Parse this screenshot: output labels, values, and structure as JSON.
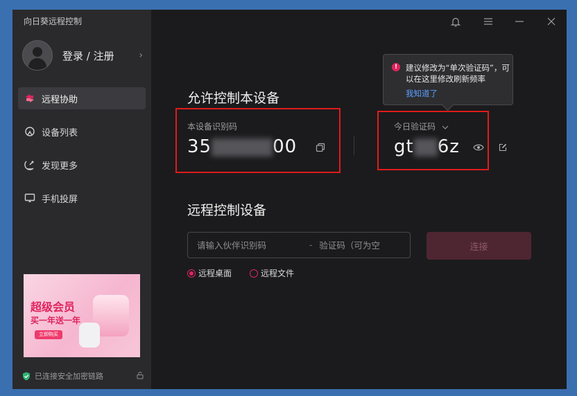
{
  "app": {
    "title": "向日葵远程控制"
  },
  "profile": {
    "login_label": "登录 / 注册"
  },
  "sidebar": {
    "items": [
      {
        "label": "远程协助",
        "icon": "remote-assist-icon"
      },
      {
        "label": "设备列表",
        "icon": "device-list-icon"
      },
      {
        "label": "发现更多",
        "icon": "discover-icon"
      },
      {
        "label": "手机投屏",
        "icon": "screen-mirror-icon"
      }
    ]
  },
  "banner": {
    "title": "超级会员",
    "subtitle": "买一年送一年",
    "button": "立即购买"
  },
  "status": {
    "text": "已连接安全加密链路"
  },
  "allow": {
    "title": "允许控制本设备",
    "id_label": "本设备识别码",
    "id_prefix": "35",
    "id_suffix": "00",
    "code_label": "今日验证码",
    "code_prefix": "gt",
    "code_suffix": "6z"
  },
  "tooltip": {
    "text": "建议修改为“单次验证码”，可以在这里修改刷新频率",
    "link": "我知道了"
  },
  "remote": {
    "title": "远程控制设备",
    "partner_placeholder": "请输入伙伴识别码",
    "code_placeholder": "验证码（可为空",
    "connect_label": "连接",
    "options": [
      {
        "label": "远程桌面",
        "selected": true
      },
      {
        "label": "远程文件",
        "selected": false
      }
    ]
  },
  "colors": {
    "accent": "#e0245e",
    "highlight_box": "#e01b1b",
    "link": "#5aa0ff"
  }
}
